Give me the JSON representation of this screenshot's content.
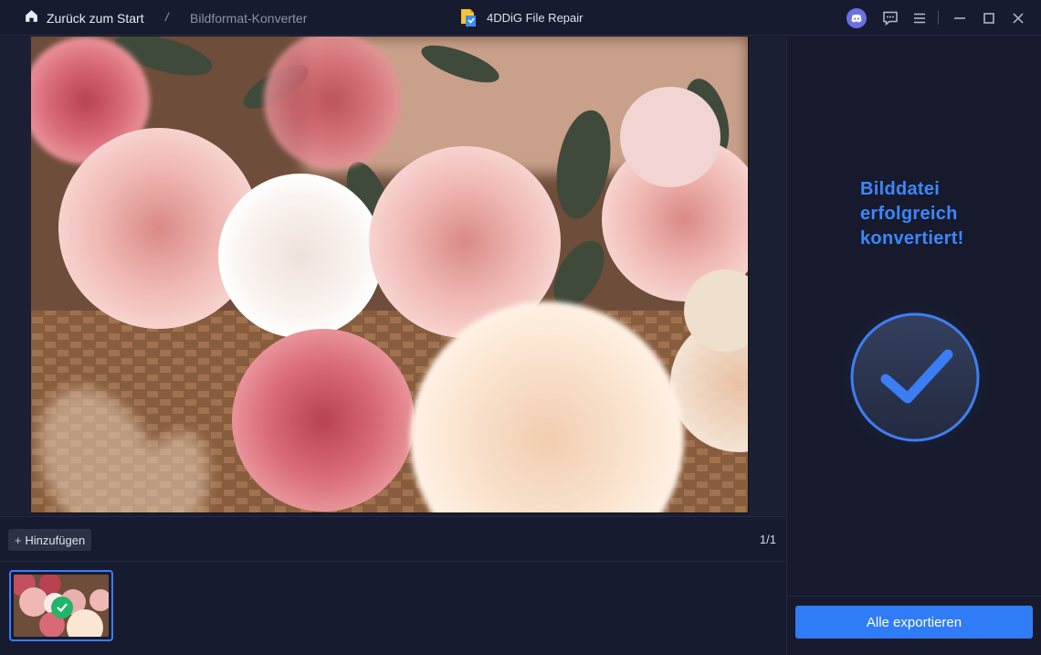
{
  "titlebar": {
    "home_label": "Zurück zum Start",
    "separator": "/",
    "current_page": "Bildformat-Konverter",
    "app_name": "4DDiG File Repair",
    "icons": [
      "home-icon",
      "app-logo-icon",
      "discord-icon",
      "feedback-icon",
      "menu-icon",
      "minimize-icon",
      "maximize-icon",
      "close-icon"
    ]
  },
  "toolbar": {
    "add_label": "Hinzufügen",
    "page_count": "1/1"
  },
  "side_panel": {
    "success_message": "Bilddatei erfolgreich konvertiert!",
    "export_label": "Alle exportieren"
  },
  "colors": {
    "accent": "#2f7cf6",
    "success_text": "#3d86ff",
    "success_check": "#21b56a",
    "background": "#171b2f"
  }
}
